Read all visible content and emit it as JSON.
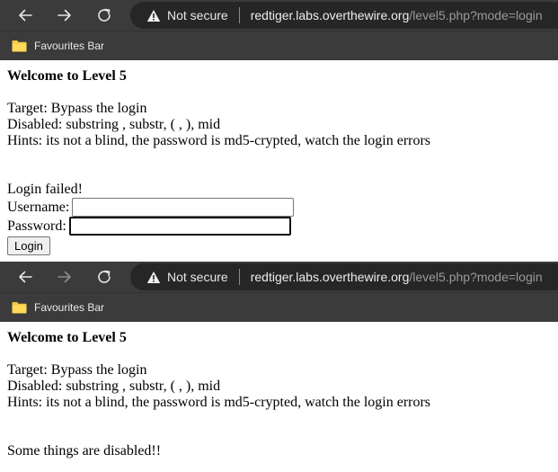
{
  "browser_top": {
    "not_secure_label": "Not secure",
    "url_host": "redtiger.labs.overthewire.org",
    "url_rest": "/level5.php?mode=login",
    "favourites_label": "Favourites Bar",
    "icons": [
      "back-arrow-icon",
      "forward-arrow-icon",
      "reload-icon",
      "warning-icon",
      "folder-icon"
    ]
  },
  "page_top": {
    "heading": "Welcome to Level 5",
    "target": "Target: Bypass the login",
    "disabled": "Disabled: substring , substr, ( , ), mid",
    "hints": "Hints: its not a blind, the password is md5-crypted, watch the login errors",
    "status": "Login failed!",
    "username_label": "Username:",
    "username_value": "",
    "password_label": "Password:",
    "password_value": "",
    "login_button": "Login"
  },
  "browser_bottom": {
    "not_secure_label": "Not secure",
    "url_host": "redtiger.labs.overthewire.org",
    "url_rest": "/level5.php?mode=login",
    "favourites_label": "Favourites Bar"
  },
  "page_bottom": {
    "heading": "Welcome to Level 5",
    "target": "Target: Bypass the login",
    "disabled": "Disabled: substring , substr, ( , ), mid",
    "hints": "Hints: its not a blind, the password is md5-crypted, watch the login errors",
    "status": "Some things are disabled!!"
  },
  "colors": {
    "toolbar_bg": "#3b3b3b",
    "omnibox_bg": "#262626",
    "folder_yellow": "#f5c842"
  }
}
